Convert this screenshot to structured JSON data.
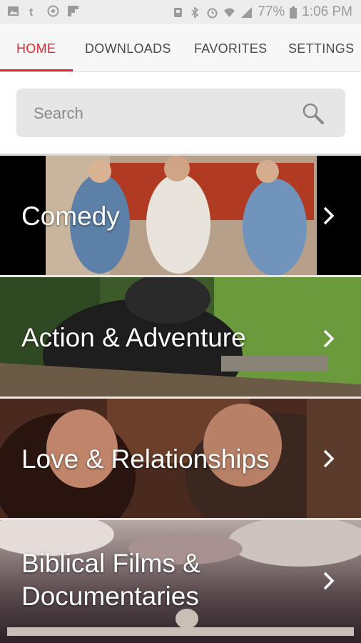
{
  "status_bar": {
    "battery": "77%",
    "time": "1:06 PM",
    "left_icons": [
      "image-icon",
      "tumblr-icon",
      "sync-icon",
      "flipboard-icon"
    ],
    "right_icons": [
      "nfc-icon",
      "bluetooth-icon",
      "alarm-icon",
      "wifi-icon",
      "signal-icon",
      "battery-icon"
    ]
  },
  "tabs": [
    {
      "label": "HOME",
      "active": true
    },
    {
      "label": "DOWNLOADS",
      "active": false
    },
    {
      "label": "FAVORITES",
      "active": false
    },
    {
      "label": "SETTINGS",
      "active": false
    }
  ],
  "search": {
    "placeholder": "Search",
    "icon": "search-icon"
  },
  "categories": [
    {
      "title": "Comedy",
      "icon": "chevron-right-icon"
    },
    {
      "title": "Action & Adventure",
      "icon": "chevron-right-icon"
    },
    {
      "title": "Love & Relationships",
      "icon": "chevron-right-icon"
    },
    {
      "title_line1": "Biblical Films &",
      "title_line2": "Documentaries",
      "icon": "chevron-right-icon"
    }
  ],
  "colors": {
    "accent": "#e3272c",
    "tab_text": "#4a4a4a",
    "search_bg": "#e6e6e6"
  }
}
